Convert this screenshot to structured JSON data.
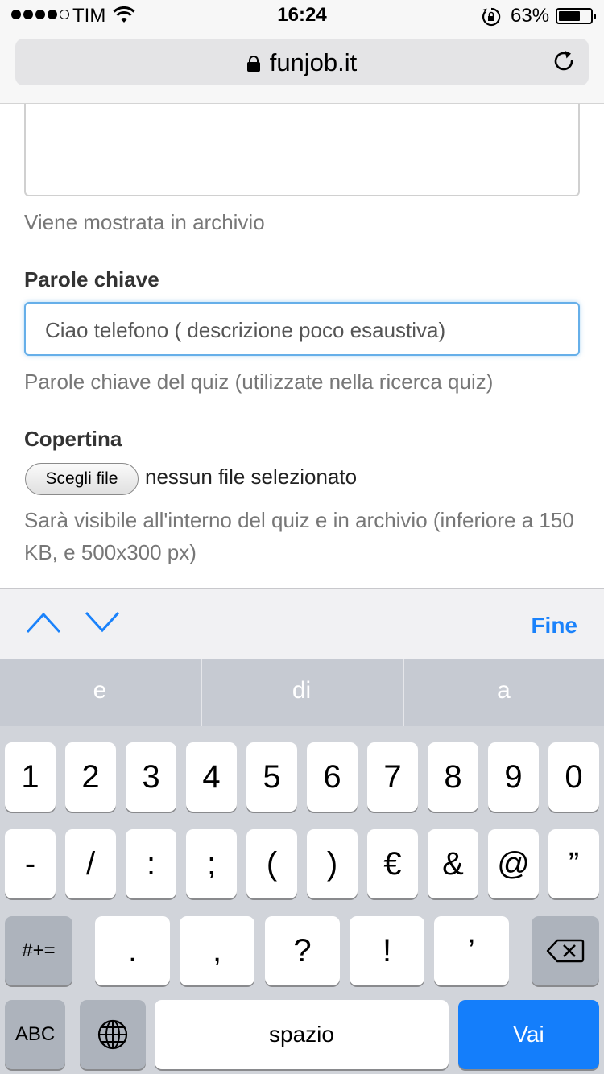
{
  "status_bar": {
    "carrier": "TIM",
    "time": "16:24",
    "battery_percent": "63%",
    "battery_level": 0.63
  },
  "browser": {
    "url": "funjob.it"
  },
  "form": {
    "description_help": "Viene mostrata in archivio",
    "keywords_label": "Parole chiave",
    "keywords_value": "Ciao telefono ( descrizione poco esaustiva)",
    "keywords_help": "Parole chiave del quiz (utilizzate nella ricerca quiz)",
    "cover_label": "Copertina",
    "file_button_label": "Scegli file",
    "file_status": "nessun file selezionato",
    "cover_help": "Sarà visibile all'interno del quiz e in archivio (inferiore a 150 KB, e 500x300 px)"
  },
  "assist_bar": {
    "done_label": "Fine"
  },
  "keyboard": {
    "suggestions": [
      "e",
      "di",
      "a"
    ],
    "row1": [
      "1",
      "2",
      "3",
      "4",
      "5",
      "6",
      "7",
      "8",
      "9",
      "0"
    ],
    "row2": [
      "-",
      "/",
      ":",
      ";",
      "(",
      ")",
      "€",
      "&",
      "@",
      "”"
    ],
    "row3_toggle": "#+=",
    "row3": [
      ".",
      ",",
      "?",
      "!",
      "’"
    ],
    "abc_label": "ABC",
    "space_label": "spazio",
    "go_label": "Vai"
  },
  "colors": {
    "accent": "#147efb",
    "focus_border": "#66afe9",
    "keyboard_bg": "#d1d4da"
  }
}
